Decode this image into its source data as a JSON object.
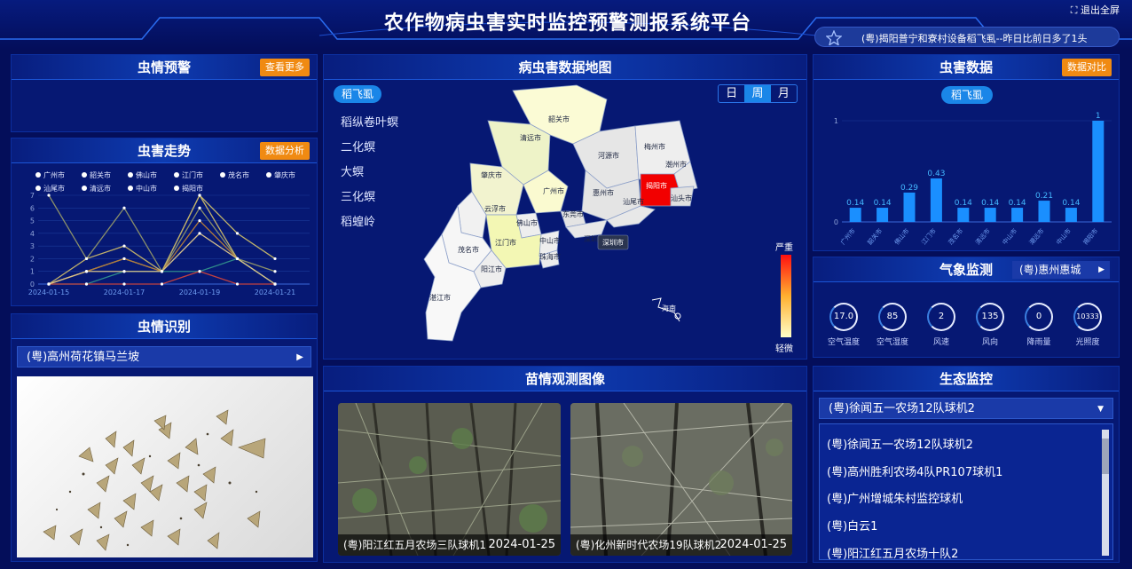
{
  "header": {
    "title": "农作物病虫害实时监控预警测报系统平台",
    "exit_label": "退出全屏"
  },
  "ticker": {
    "text": "(粤)揭阳普宁和寮村设备稻飞虱--昨日比前日多了1头"
  },
  "alert_panel": {
    "title": "虫情预警",
    "more_label": "查看更多"
  },
  "trend_panel": {
    "title": "虫害走势",
    "analysis_label": "数据分析",
    "legend": [
      "广州市",
      "韶关市",
      "佛山市",
      "江门市",
      "茂名市",
      "肇庆市",
      "汕尾市",
      "清远市",
      "中山市",
      "揭阳市"
    ],
    "yticks": [
      "0",
      "1",
      "2",
      "3",
      "4",
      "5",
      "6",
      "7"
    ],
    "xticks": [
      "2024-01-15",
      "2024-01-17",
      "2024-01-19",
      "2024-01-21"
    ]
  },
  "identify_panel": {
    "title": "虫情识别",
    "location": "(粤)高州荷花镇马兰坡"
  },
  "map_panel": {
    "title": "病虫害数据地图",
    "pests": [
      "稻飞虱",
      "稻纵卷叶螟",
      "二化螟",
      "大螟",
      "三化螟",
      "稻蝗岭"
    ],
    "period_tabs": [
      "日",
      "周",
      "月"
    ],
    "cities": [
      "韶关市",
      "清远市",
      "河源市",
      "梅州市",
      "潮州市",
      "肇庆市",
      "广州市",
      "惠州市",
      "揭阳市",
      "汕头市",
      "汕尾市",
      "云浮市",
      "佛山市",
      "东莞市",
      "深圳市",
      "江门市",
      "中山市",
      "珠海市",
      "茂名市",
      "阳江市",
      "湛江市",
      "海南"
    ],
    "tooltip": "深圳市",
    "legend_high": "严重",
    "legend_low": "轻微"
  },
  "seedling_panel": {
    "title": "苗情观测图像",
    "cams": [
      {
        "name": "(粤)阳江红五月农场三队球机1",
        "date": "2024-01-25"
      },
      {
        "name": "(粤)化州新时代农场19队球机2",
        "date": "2024-01-25"
      }
    ]
  },
  "pest_data_panel": {
    "title": "虫害数据",
    "compare_label": "数据对比",
    "pest": "稻飞虱",
    "yticks": [
      "0",
      "1"
    ]
  },
  "chart_data": {
    "type": "bar",
    "categories": [
      "广州市",
      "韶关市",
      "佛山市",
      "江门市",
      "茂名市",
      "清远市",
      "中山市",
      "潮远市",
      "中山市",
      "揭阳市"
    ],
    "values": [
      0.14,
      0.14,
      0.29,
      0.43,
      0.14,
      0.14,
      0.14,
      0.21,
      0.14,
      1
    ],
    "ylim": [
      0,
      1
    ]
  },
  "weather_panel": {
    "title": "气象监测",
    "location": "(粤)惠州惠城",
    "metrics": [
      {
        "value": "17.0",
        "label": "空气温度"
      },
      {
        "value": "85",
        "label": "空气湿度"
      },
      {
        "value": "2",
        "label": "风速"
      },
      {
        "value": "135",
        "label": "风向"
      },
      {
        "value": "0",
        "label": "降雨量"
      },
      {
        "value": "10333",
        "label": "光照度"
      }
    ]
  },
  "eco_panel": {
    "title": "生态监控",
    "selected": "(粤)徐闻五一农场12队球机2",
    "options": [
      "(粤)徐闻五一农场12队球机2",
      "(粤)高州胜利农场4队PR107球机1",
      "(粤)广州增城朱村监控球机",
      "(粤)白云1",
      "(粤)阳江红五月农场十队2"
    ]
  }
}
